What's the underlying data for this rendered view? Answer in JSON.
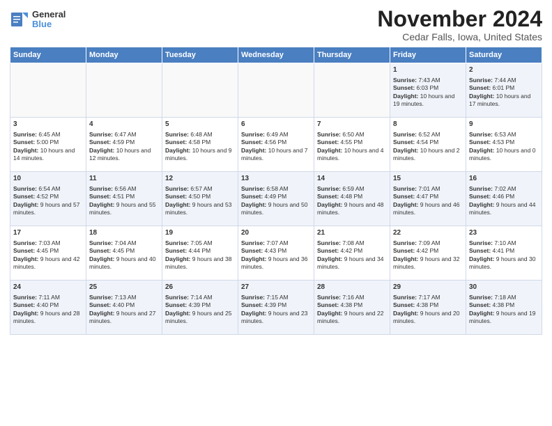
{
  "header": {
    "logo_general": "General",
    "logo_blue": "Blue",
    "main_title": "November 2024",
    "subtitle": "Cedar Falls, Iowa, United States"
  },
  "days_of_week": [
    "Sunday",
    "Monday",
    "Tuesday",
    "Wednesday",
    "Thursday",
    "Friday",
    "Saturday"
  ],
  "weeks": [
    [
      {
        "day": "",
        "content": ""
      },
      {
        "day": "",
        "content": ""
      },
      {
        "day": "",
        "content": ""
      },
      {
        "day": "",
        "content": ""
      },
      {
        "day": "",
        "content": ""
      },
      {
        "day": "1",
        "content": "Sunrise: 7:43 AM\nSunset: 6:03 PM\nDaylight: 10 hours and 19 minutes."
      },
      {
        "day": "2",
        "content": "Sunrise: 7:44 AM\nSunset: 6:01 PM\nDaylight: 10 hours and 17 minutes."
      }
    ],
    [
      {
        "day": "3",
        "content": "Sunrise: 6:45 AM\nSunset: 5:00 PM\nDaylight: 10 hours and 14 minutes."
      },
      {
        "day": "4",
        "content": "Sunrise: 6:47 AM\nSunset: 4:59 PM\nDaylight: 10 hours and 12 minutes."
      },
      {
        "day": "5",
        "content": "Sunrise: 6:48 AM\nSunset: 4:58 PM\nDaylight: 10 hours and 9 minutes."
      },
      {
        "day": "6",
        "content": "Sunrise: 6:49 AM\nSunset: 4:56 PM\nDaylight: 10 hours and 7 minutes."
      },
      {
        "day": "7",
        "content": "Sunrise: 6:50 AM\nSunset: 4:55 PM\nDaylight: 10 hours and 4 minutes."
      },
      {
        "day": "8",
        "content": "Sunrise: 6:52 AM\nSunset: 4:54 PM\nDaylight: 10 hours and 2 minutes."
      },
      {
        "day": "9",
        "content": "Sunrise: 6:53 AM\nSunset: 4:53 PM\nDaylight: 10 hours and 0 minutes."
      }
    ],
    [
      {
        "day": "10",
        "content": "Sunrise: 6:54 AM\nSunset: 4:52 PM\nDaylight: 9 hours and 57 minutes."
      },
      {
        "day": "11",
        "content": "Sunrise: 6:56 AM\nSunset: 4:51 PM\nDaylight: 9 hours and 55 minutes."
      },
      {
        "day": "12",
        "content": "Sunrise: 6:57 AM\nSunset: 4:50 PM\nDaylight: 9 hours and 53 minutes."
      },
      {
        "day": "13",
        "content": "Sunrise: 6:58 AM\nSunset: 4:49 PM\nDaylight: 9 hours and 50 minutes."
      },
      {
        "day": "14",
        "content": "Sunrise: 6:59 AM\nSunset: 4:48 PM\nDaylight: 9 hours and 48 minutes."
      },
      {
        "day": "15",
        "content": "Sunrise: 7:01 AM\nSunset: 4:47 PM\nDaylight: 9 hours and 46 minutes."
      },
      {
        "day": "16",
        "content": "Sunrise: 7:02 AM\nSunset: 4:46 PM\nDaylight: 9 hours and 44 minutes."
      }
    ],
    [
      {
        "day": "17",
        "content": "Sunrise: 7:03 AM\nSunset: 4:45 PM\nDaylight: 9 hours and 42 minutes."
      },
      {
        "day": "18",
        "content": "Sunrise: 7:04 AM\nSunset: 4:45 PM\nDaylight: 9 hours and 40 minutes."
      },
      {
        "day": "19",
        "content": "Sunrise: 7:05 AM\nSunset: 4:44 PM\nDaylight: 9 hours and 38 minutes."
      },
      {
        "day": "20",
        "content": "Sunrise: 7:07 AM\nSunset: 4:43 PM\nDaylight: 9 hours and 36 minutes."
      },
      {
        "day": "21",
        "content": "Sunrise: 7:08 AM\nSunset: 4:42 PM\nDaylight: 9 hours and 34 minutes."
      },
      {
        "day": "22",
        "content": "Sunrise: 7:09 AM\nSunset: 4:42 PM\nDaylight: 9 hours and 32 minutes."
      },
      {
        "day": "23",
        "content": "Sunrise: 7:10 AM\nSunset: 4:41 PM\nDaylight: 9 hours and 30 minutes."
      }
    ],
    [
      {
        "day": "24",
        "content": "Sunrise: 7:11 AM\nSunset: 4:40 PM\nDaylight: 9 hours and 28 minutes."
      },
      {
        "day": "25",
        "content": "Sunrise: 7:13 AM\nSunset: 4:40 PM\nDaylight: 9 hours and 27 minutes."
      },
      {
        "day": "26",
        "content": "Sunrise: 7:14 AM\nSunset: 4:39 PM\nDaylight: 9 hours and 25 minutes."
      },
      {
        "day": "27",
        "content": "Sunrise: 7:15 AM\nSunset: 4:39 PM\nDaylight: 9 hours and 23 minutes."
      },
      {
        "day": "28",
        "content": "Sunrise: 7:16 AM\nSunset: 4:38 PM\nDaylight: 9 hours and 22 minutes."
      },
      {
        "day": "29",
        "content": "Sunrise: 7:17 AM\nSunset: 4:38 PM\nDaylight: 9 hours and 20 minutes."
      },
      {
        "day": "30",
        "content": "Sunrise: 7:18 AM\nSunset: 4:38 PM\nDaylight: 9 hours and 19 minutes."
      }
    ]
  ]
}
